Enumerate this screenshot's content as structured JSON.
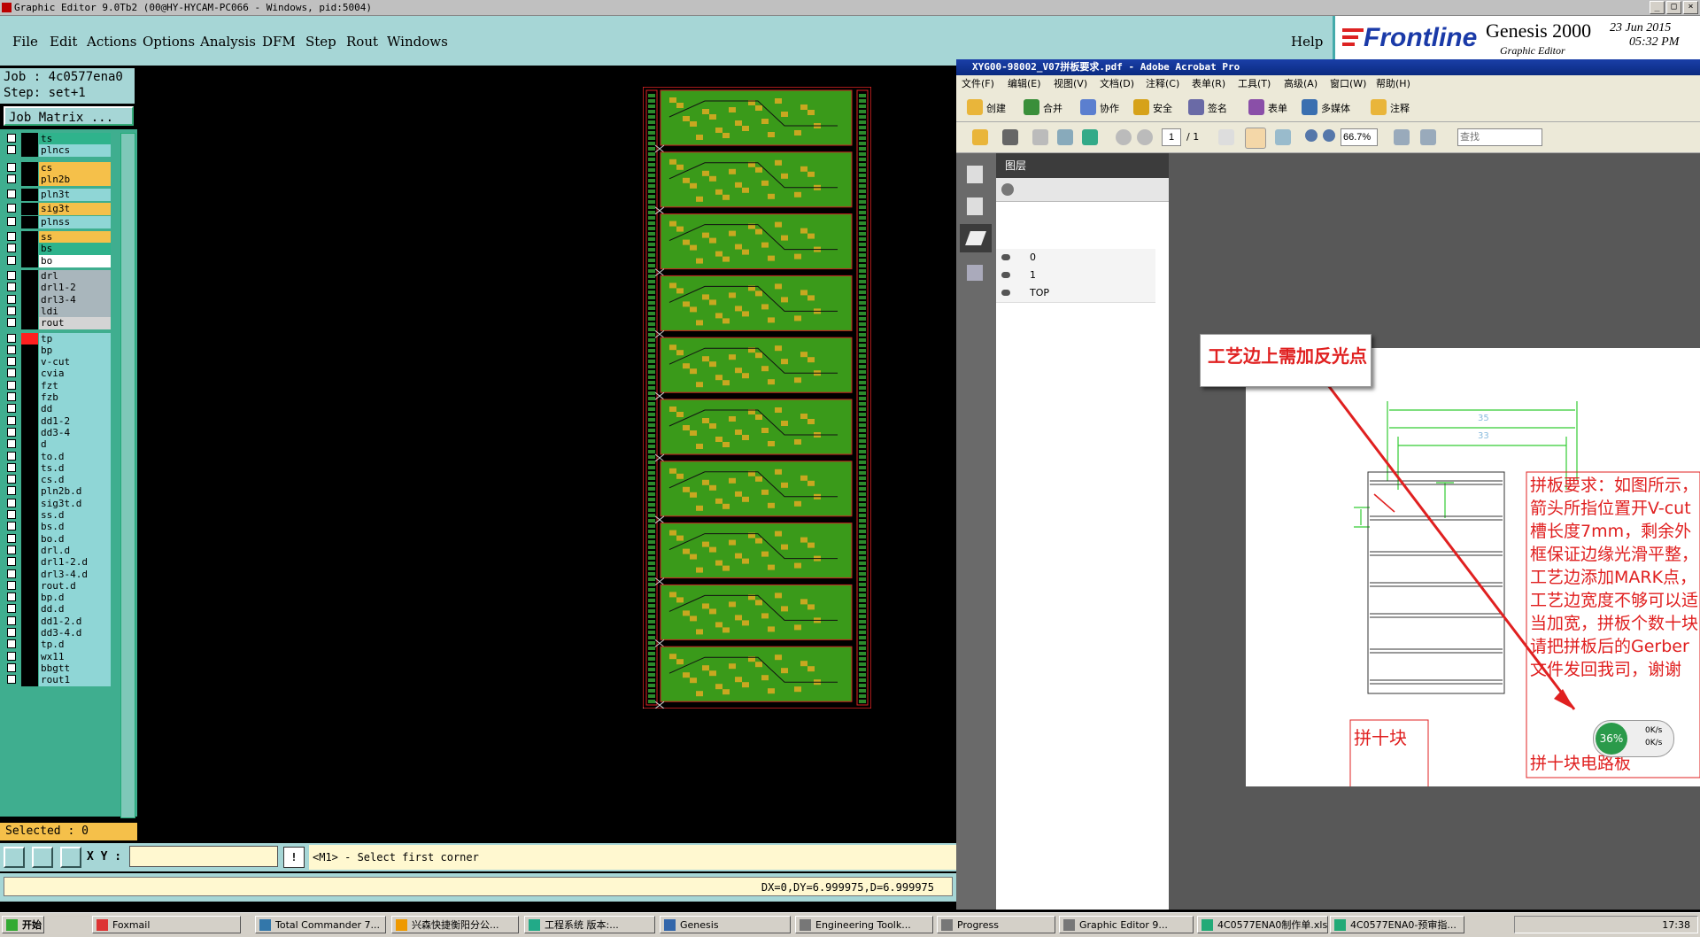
{
  "window": {
    "title": "Graphic Editor 9.0Tb2 (00@HY-HYCAM-PC066 - Windows, pid:5004)"
  },
  "menu": [
    "File",
    "Edit",
    "Actions",
    "Options",
    "Analysis",
    "DFM",
    "Step",
    "Rout",
    "Windows"
  ],
  "help": "Help",
  "brand": {
    "name": "Frontline",
    "product": "Genesis 2000",
    "sub": "Graphic Editor",
    "date": "23 Jun 2015",
    "time": "05:32 PM"
  },
  "job": {
    "job_label": "Job : 4c0577ena0",
    "step_label": "Step: set+1",
    "matrix_button": "Job Matrix ..."
  },
  "colors": {
    "green": "#2fb38c",
    "yellow": "#f5c04a",
    "white": "#ffffff",
    "grey": "#a9b6bc",
    "cyan": "#8fd6d6",
    "red": "#ff2020"
  },
  "layers": [
    {
      "name": "ts",
      "color": "#2fb38c"
    },
    {
      "name": "plncs",
      "color": "#8fd6d6"
    },
    {
      "name": "cs",
      "color": "#f5c04a"
    },
    {
      "name": "pln2b",
      "color": "#f5c04a"
    },
    {
      "name": "pln3t",
      "color": "#8fd6d6"
    },
    {
      "name": "sig3t",
      "color": "#f5c04a"
    },
    {
      "name": "plnss",
      "color": "#8fd6d6"
    },
    {
      "name": "ss",
      "color": "#f5c04a"
    },
    {
      "name": "bs",
      "color": "#2fb38c"
    },
    {
      "name": "bo",
      "color": "#ffffff"
    },
    {
      "name": "drl",
      "color": "#a9b6bc"
    },
    {
      "name": "drl1-2",
      "color": "#a9b6bc"
    },
    {
      "name": "drl3-4",
      "color": "#a9b6bc"
    },
    {
      "name": "ldi",
      "color": "#a9b6bc"
    },
    {
      "name": "rout",
      "color": "#d4d4d4"
    },
    {
      "name": "tp",
      "color": "#8fd6d6"
    },
    {
      "name": "bp",
      "color": "#8fd6d6"
    },
    {
      "name": "v-cut",
      "color": "#8fd6d6"
    },
    {
      "name": "cvia",
      "color": "#8fd6d6"
    },
    {
      "name": "fzt",
      "color": "#8fd6d6"
    },
    {
      "name": "fzb",
      "color": "#8fd6d6"
    },
    {
      "name": "dd",
      "color": "#8fd6d6"
    },
    {
      "name": "dd1-2",
      "color": "#8fd6d6"
    },
    {
      "name": "dd3-4",
      "color": "#8fd6d6"
    },
    {
      "name": "d",
      "color": "#8fd6d6"
    },
    {
      "name": "to.d",
      "color": "#8fd6d6"
    },
    {
      "name": "ts.d",
      "color": "#8fd6d6"
    },
    {
      "name": "cs.d",
      "color": "#8fd6d6"
    },
    {
      "name": "pln2b.d",
      "color": "#8fd6d6"
    },
    {
      "name": "sig3t.d",
      "color": "#8fd6d6"
    },
    {
      "name": "ss.d",
      "color": "#8fd6d6"
    },
    {
      "name": "bs.d",
      "color": "#8fd6d6"
    },
    {
      "name": "bo.d",
      "color": "#8fd6d6"
    },
    {
      "name": "drl.d",
      "color": "#8fd6d6"
    },
    {
      "name": "drl1-2.d",
      "color": "#8fd6d6"
    },
    {
      "name": "drl3-4.d",
      "color": "#8fd6d6"
    },
    {
      "name": "rout.d",
      "color": "#8fd6d6"
    },
    {
      "name": "bp.d",
      "color": "#8fd6d6"
    },
    {
      "name": "dd.d",
      "color": "#8fd6d6"
    },
    {
      "name": "dd1-2.d",
      "color": "#8fd6d6"
    },
    {
      "name": "dd3-4.d",
      "color": "#8fd6d6"
    },
    {
      "name": "tp.d",
      "color": "#8fd6d6"
    },
    {
      "name": "wx11",
      "color": "#8fd6d6"
    },
    {
      "name": "bbgtt",
      "color": "#8fd6d6"
    },
    {
      "name": "rout1",
      "color": "#8fd6d6"
    }
  ],
  "selected": "Selected : 0",
  "xy_label": "X Y :",
  "prompt": "<M1> - Select first corner",
  "status": "DX=0,DY=6.999975,D=6.999975",
  "acrobat": {
    "title": "XYG00-98002_V07拼板要求.pdf - Adobe Acrobat Pro",
    "menu": [
      "文件(F)",
      "编辑(E)",
      "视图(V)",
      "文档(D)",
      "注释(C)",
      "表单(R)",
      "工具(T)",
      "高级(A)",
      "窗口(W)",
      "帮助(H)"
    ],
    "toolbar": [
      "创建",
      "合并",
      "协作",
      "安全",
      "签名",
      "表单",
      "多媒体",
      "注释"
    ],
    "page_current": "1",
    "page_total": "/ 1",
    "zoom": "66.7%",
    "search_placeholder": "查找",
    "layers_panel_title": "图层",
    "layer_names": [
      "0",
      "1",
      "TOP"
    ],
    "callout": "工艺边上需加反光点",
    "requirement": "拼板要求：如图所示，箭头所指位置开V-cut槽长度7mm，剩余外框保证边缘光滑平整，工艺边添加MARK点，工艺边宽度不够可以适当加宽，拼板个数十块请把拼板后的Gerber文件发回我司，谢谢",
    "requirement_tail": "拼十块电路板",
    "box_label": "拼十块",
    "dim_top": "35",
    "dim_second": "33",
    "netspeed_pct": "36%",
    "net_up": "0K/s",
    "net_down": "0K/s"
  },
  "taskbar": {
    "start": "开始",
    "tasks": [
      "Foxmail",
      "Total Commander 7...",
      "兴森快捷衡阳分公...",
      "工程系统  版本:...",
      "Genesis",
      "Engineering Toolk...",
      "Progress",
      "Graphic Editor 9...",
      "4C0577ENA0制作单.xls",
      "4C0577ENA0-预审指..."
    ],
    "clock": "17:38"
  }
}
